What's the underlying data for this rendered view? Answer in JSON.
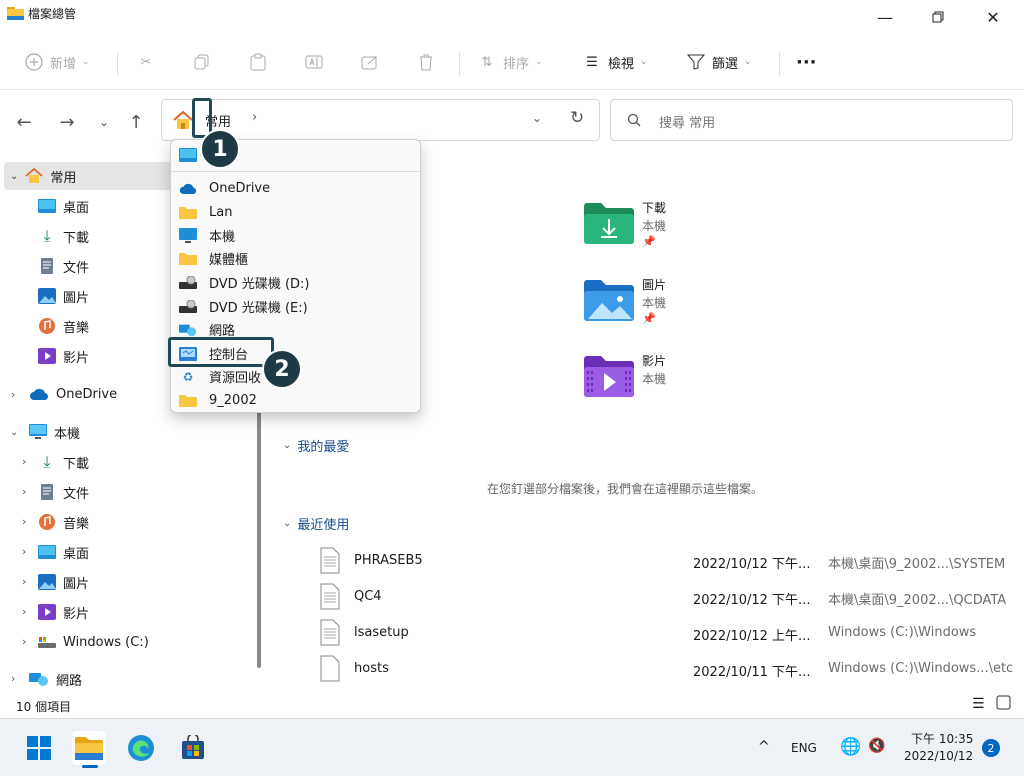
{
  "window": {
    "title": "檔案總管"
  },
  "commandbar": {
    "new_label": "新增",
    "sort_label": "排序",
    "view_label": "檢視",
    "filter_label": "篩選"
  },
  "navbar": {
    "breadcrumb": "常用",
    "search_placeholder": "搜尋 常用"
  },
  "sidebar": {
    "home": "常用",
    "quick": [
      "桌面",
      "下載",
      "文件",
      "圖片",
      "音樂",
      "影片"
    ],
    "onedrive": "OneDrive",
    "thispc": "本機",
    "pc_items": [
      "下載",
      "文件",
      "音樂",
      "桌面",
      "圖片",
      "影片",
      "Windows (C:)"
    ],
    "network": "網路"
  },
  "dropdown": {
    "items": [
      "OneDrive",
      "Lan",
      "本機",
      "媒體櫃",
      "DVD 光碟機 (D:)",
      "DVD 光碟機 (E:)",
      "網路",
      "控制台",
      "資源回收",
      "9_2002"
    ]
  },
  "callouts": {
    "one": "1",
    "two": "2"
  },
  "quick_access": [
    {
      "name": "下載",
      "sub": "本機"
    },
    {
      "name": "圖片",
      "sub": "本機"
    },
    {
      "name": "影片",
      "sub": "本機"
    }
  ],
  "favorites": {
    "header": "我的最愛",
    "empty": "在您釘選部分檔案後，我們會在這裡顯示這些檔案。"
  },
  "recent": {
    "header": "最近使用",
    "rows": [
      {
        "name": "PHRASEB5",
        "date": "2022/10/12 下午...",
        "path": "本機\\桌面\\9_2002...\\SYSTEM"
      },
      {
        "name": "QC4",
        "date": "2022/10/12 下午...",
        "path": "本機\\桌面\\9_2002...\\QCDATA"
      },
      {
        "name": "lsasetup",
        "date": "2022/10/12 上午...",
        "path": "Windows (C:)\\Windows"
      },
      {
        "name": "hosts",
        "date": "2022/10/11 下午...",
        "path": "Windows (C:)\\Windows...\\etc"
      }
    ]
  },
  "status": {
    "count": "10 個項目"
  },
  "taskbar": {
    "lang": "ENG",
    "time": "下午 10:35",
    "date": "2022/10/12",
    "badge": "2"
  },
  "colors": {
    "accent": "#0067c0",
    "callout": "#1f3a44"
  }
}
